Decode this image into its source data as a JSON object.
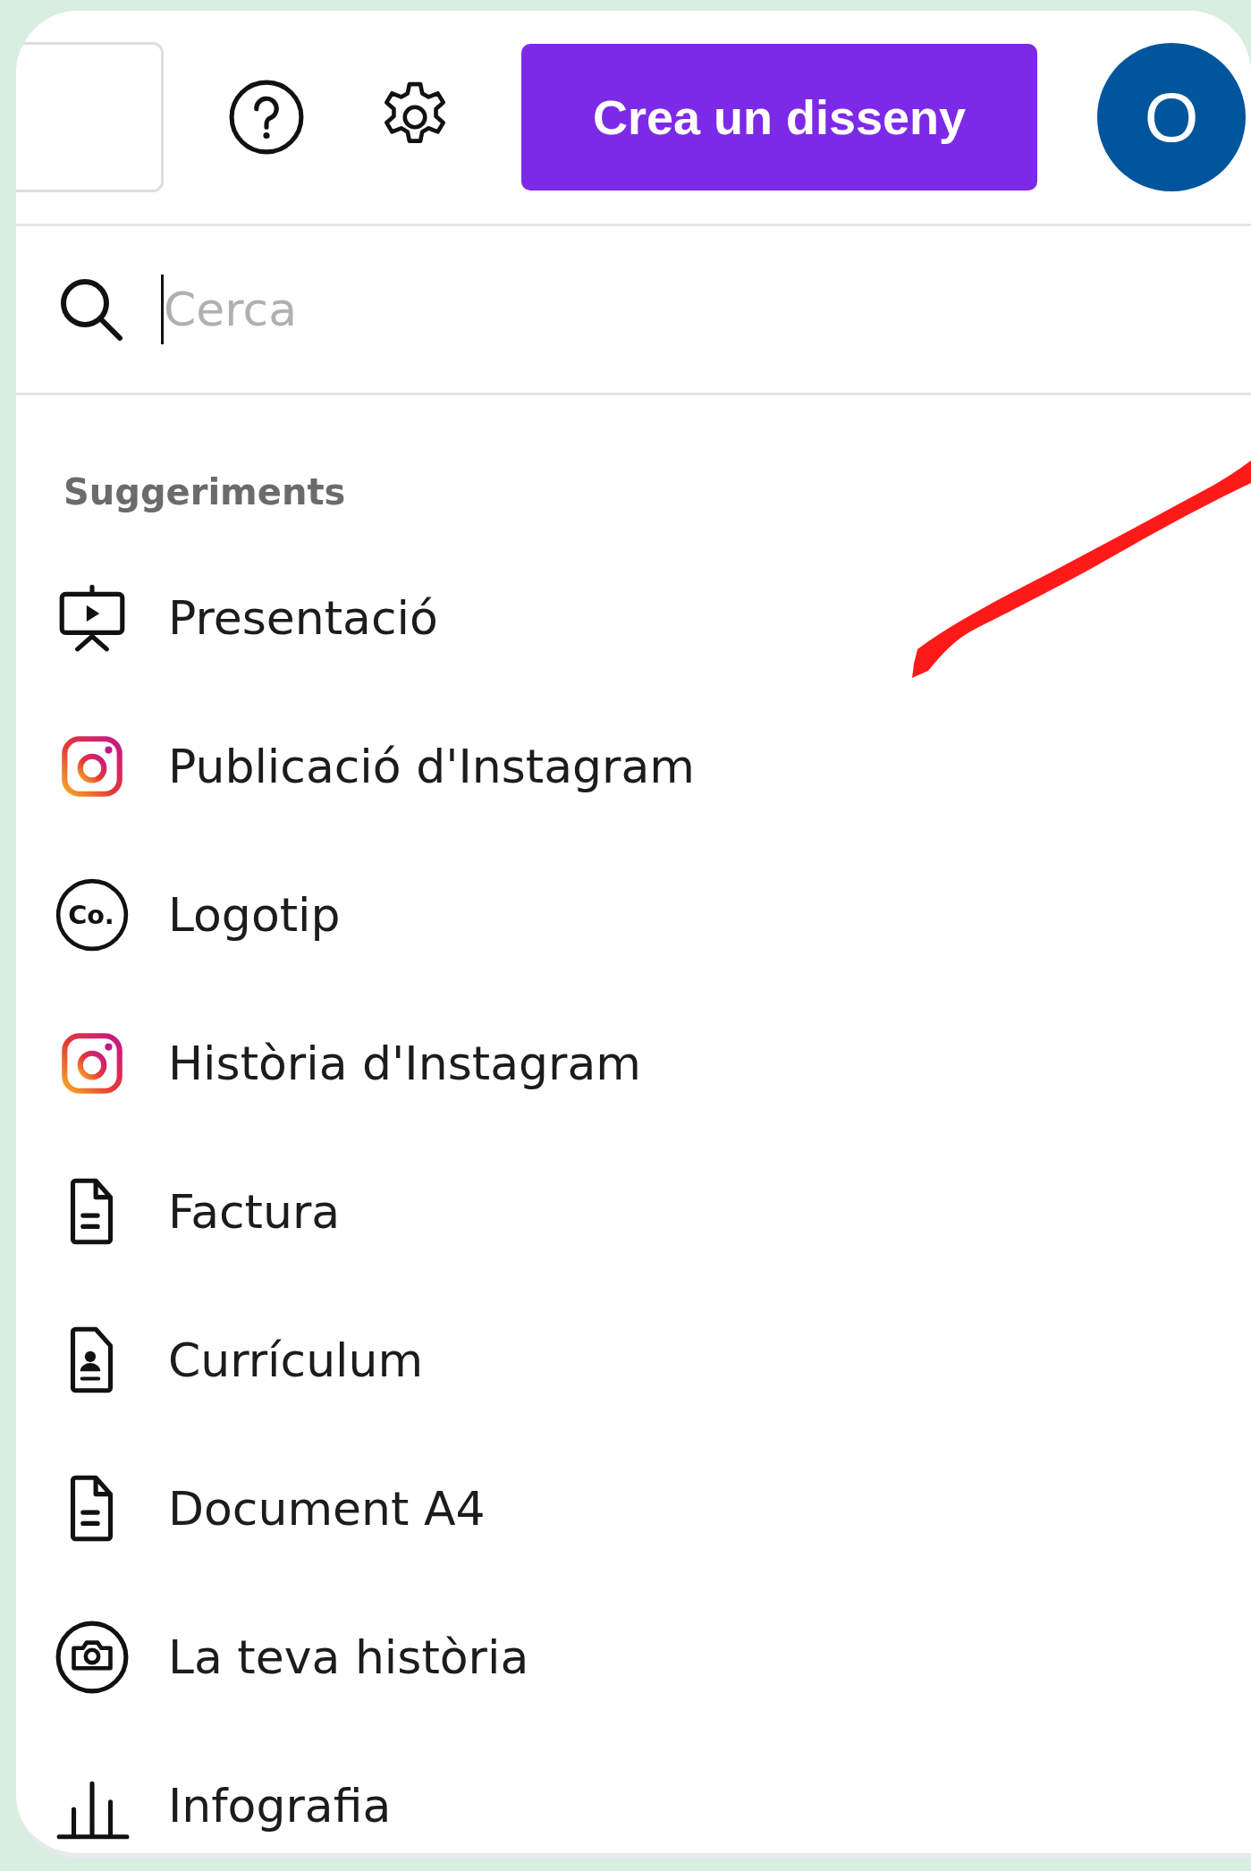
{
  "top_bar": {
    "create_button": "Crea un disseny",
    "avatar": "O"
  },
  "search": {
    "placeholder": "Cerca",
    "focused": true
  },
  "suggestions": {
    "heading": "Suggeriments",
    "items": [
      {
        "label": "Presentació",
        "kind": "presentation"
      },
      {
        "label": "Publicació d'Instagram",
        "kind": "instagram"
      },
      {
        "label": "Logotip",
        "kind": "logo",
        "icon_text": "Co."
      },
      {
        "label": "Història d'Instagram",
        "kind": "instagram"
      },
      {
        "label": "Factura",
        "kind": "document"
      },
      {
        "label": "Currículum",
        "kind": "resume"
      },
      {
        "label": "Document A4",
        "kind": "document"
      },
      {
        "label": "La teva història",
        "kind": "camera"
      },
      {
        "label": "Infografia",
        "kind": "chart"
      }
    ]
  }
}
